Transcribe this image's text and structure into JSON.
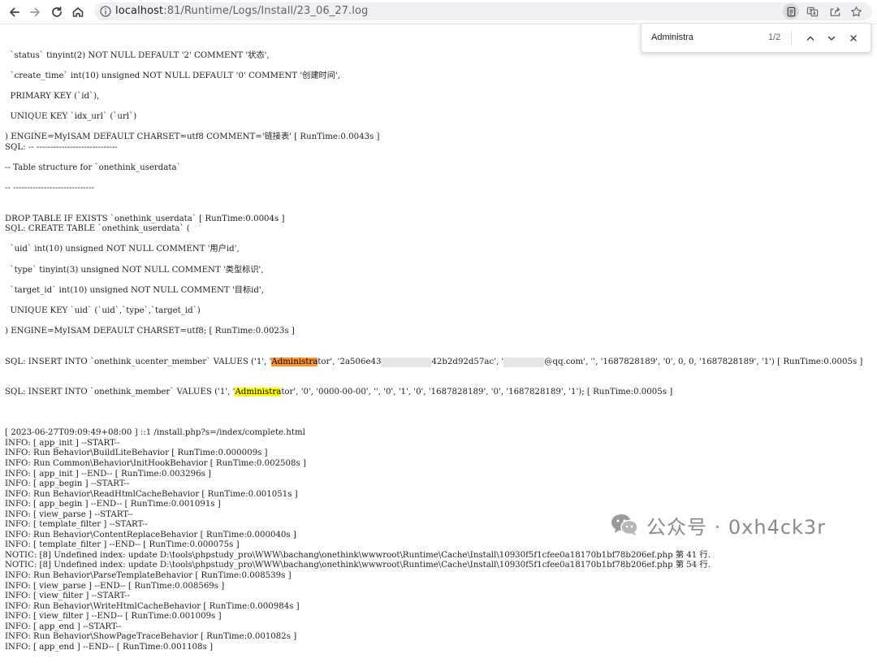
{
  "browser": {
    "url_host": "localhost",
    "url_path": ":81/Runtime/Logs/Install/23_06_27.log",
    "icons": [
      "back-icon",
      "forward-icon",
      "reload-icon",
      "home-icon",
      "info-icon",
      "reading-mode-icon",
      "translate-icon",
      "share-icon",
      "bookmark-star-icon"
    ]
  },
  "find_bar": {
    "query": "Administra",
    "count": "1/2",
    "icons": [
      "chevron-up-icon",
      "chevron-down-icon",
      "close-icon"
    ]
  },
  "log": {
    "lines": [
      "  `status` tinyint(2) NOT NULL DEFAULT '2' COMMENT '状态',",
      "",
      "  `create_time` int(10) unsigned NOT NULL DEFAULT '0' COMMENT '创建时间',",
      "",
      "  PRIMARY KEY (`id`),",
      "",
      "  UNIQUE KEY `idx_url` (`url`)",
      "",
      ") ENGINE=MyISAM DEFAULT CHARSET=utf8 COMMENT='链接表' [ RunTime:0.0043s ]",
      "SQL: -- -----------------------------",
      "",
      "-- Table structure for `onethink_userdata`",
      "",
      "-- -----------------------------",
      "",
      "",
      "DROP TABLE IF EXISTS `onethink_userdata` [ RunTime:0.0004s ]",
      "SQL: CREATE TABLE `onethink_userdata` (",
      "",
      "  `uid` int(10) unsigned NOT NULL COMMENT '用户id',",
      "",
      "  `type` tinyint(3) unsigned NOT NULL COMMENT '类型标识',",
      "",
      "  `target_id` int(10) unsigned NOT NULL COMMENT '目标id',",
      "",
      "  UNIQUE KEY `uid` (`uid`,`type`,`target_id`)",
      "",
      ") ENGINE=MyISAM DEFAULT CHARSET=utf8; [ RunTime:0.0023s ]"
    ],
    "sql1": {
      "a": "SQL: INSERT INTO `onethink_ucenter_member` VALUES ('1', '",
      "hl": "Administra",
      "b": "tor', '2a506e43",
      "c": "42b2d92d57ac', '",
      "d": "@qq.com', '', '1687828189', '0', 0, 0, '1687828189', '1') [ RunTime:0.0005s ]"
    },
    "sql2": {
      "a": "SQL: INSERT INTO `onethink_member` VALUES ('1', '",
      "hl": "Administra",
      "b": "tor', '0', '0000-00-00', '', '0', '1', '0', '1687828189', '0', '1687828189', '1'); [ RunTime:0.0005s ]"
    },
    "lines2": [
      "",
      "[ 2023-06-27T09:09:49+08:00 ] ::1 /install.php?s=/index/complete.html",
      "INFO: [ app_init ] --START--",
      "INFO: Run Behavior\\BuildLiteBehavior [ RunTime:0.000009s ]",
      "INFO: Run Common\\Behavior\\InitHookBehavior [ RunTime:0.002508s ]",
      "INFO: [ app_init ] --END-- [ RunTime:0.003296s ]",
      "INFO: [ app_begin ] --START--",
      "INFO: Run Behavior\\ReadHtmlCacheBehavior [ RunTime:0.001051s ]",
      "INFO: [ app_begin ] --END-- [ RunTime:0.001091s ]",
      "INFO: [ view_parse ] --START--",
      "INFO: [ template_filter ] --START--",
      "INFO: Run Behavior\\ContentReplaceBehavior [ RunTime:0.000040s ]",
      "INFO: [ template_filter ] --END-- [ RunTime:0.000075s ]",
      "NOTIC: [8] Undefined index: update D:\\tools\\phpstudy_pro\\WWW\\bachang\\onethink\\wwwroot\\Runtime\\Cache\\Install\\10930f5f1cfee0a18170b1bf78b206ef.php 第 41 行.",
      "NOTIC: [8] Undefined index: update D:\\tools\\phpstudy_pro\\WWW\\bachang\\onethink\\wwwroot\\Runtime\\Cache\\Install\\10930f5f1cfee0a18170b1bf78b206ef.php 第 54 行.",
      "INFO: Run Behavior\\ParseTemplateBehavior [ RunTime:0.008539s ]",
      "INFO: [ view_parse ] --END-- [ RunTime:0.008569s ]",
      "INFO: [ view_filter ] --START--",
      "INFO: Run Behavior\\WriteHtmlCacheBehavior [ RunTime:0.000984s ]",
      "INFO: [ view_filter ] --END-- [ RunTime:0.001009s ]",
      "INFO: [ app_end ] --START--",
      "INFO: Run Behavior\\ShowPageTraceBehavior [ RunTime:0.001082s ]",
      "INFO: [ app_end ] --END-- [ RunTime:0.001108s ]"
    ]
  },
  "watermark": {
    "text": "公众号 · 0xh4ck3r",
    "icon": "wechat-icon"
  }
}
